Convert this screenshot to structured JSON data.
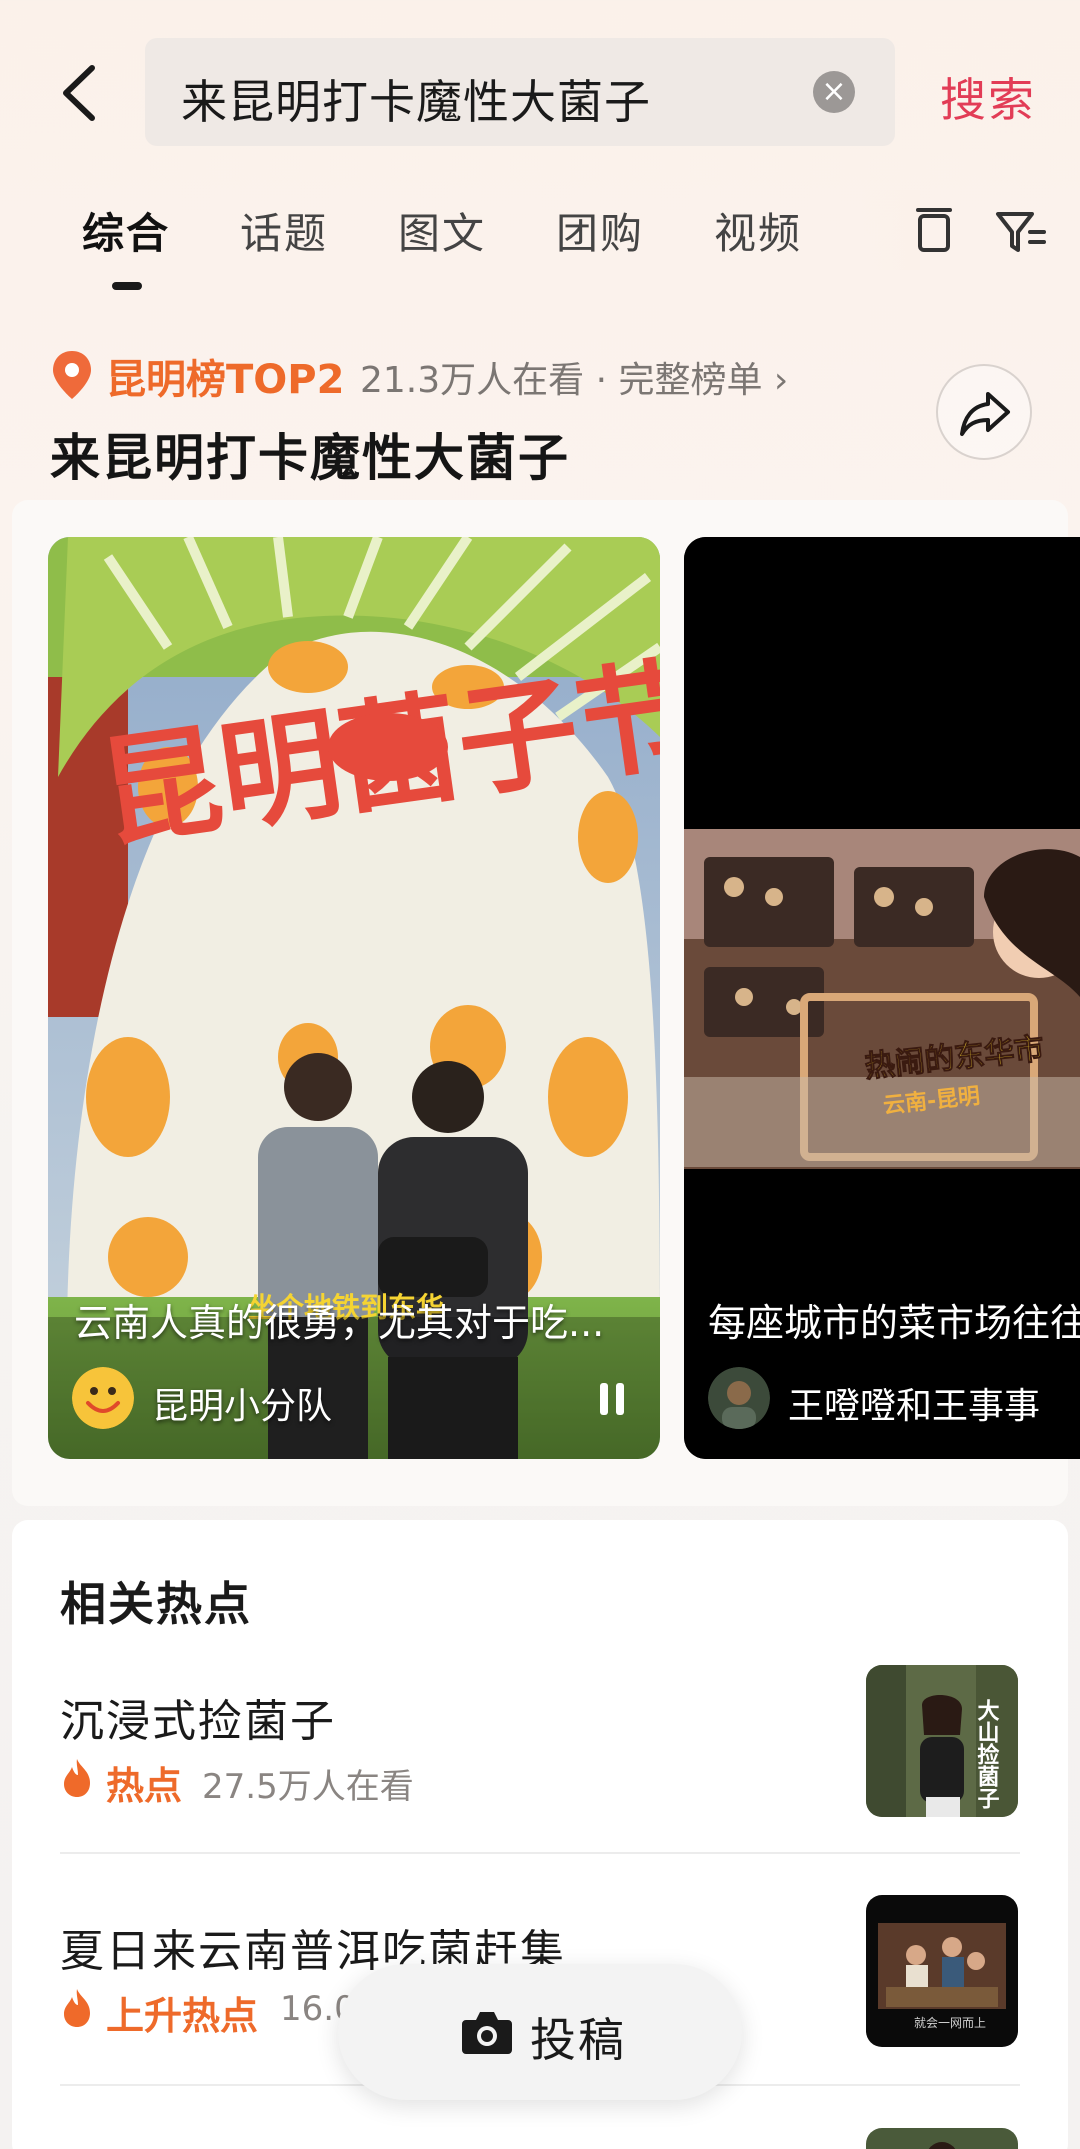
{
  "header": {
    "search_value": "来昆明打卡魔性大菌子",
    "search_button": "搜索"
  },
  "tabs": [
    {
      "label": "综合",
      "active": true
    },
    {
      "label": "话题",
      "active": false
    },
    {
      "label": "图文",
      "active": false
    },
    {
      "label": "团购",
      "active": false
    },
    {
      "label": "视频",
      "active": false
    }
  ],
  "rank": {
    "title": "昆明榜TOP2",
    "meta": "21.3万人在看 · 完整榜单 ›"
  },
  "page_title": "来昆明打卡魔性大菌子",
  "cards": [
    {
      "overlay_title": "昆明菌子节",
      "subtitle_overlay": "坐个地铁到东华",
      "caption": "云南人真的很勇，尤其对于吃...",
      "author": "昆明小分队"
    },
    {
      "overlay_title": "热闹的东华市",
      "overlay_sub": "云南-昆明",
      "caption": "每座城市的菜市场往往",
      "author": "王噔噔和王事事"
    }
  ],
  "related": {
    "heading": "相关热点",
    "items": [
      {
        "title": "沉浸式捡菌子",
        "tag": "热点",
        "views": "27.5万人在看",
        "thumb_text": "大山捡菌子"
      },
      {
        "title": "夏日来云南普洱吃菌赶集",
        "tag": "上升热点",
        "views": "16.0",
        "thumb_text": "就会一网而上"
      }
    ]
  },
  "post_button": "投稿",
  "colors": {
    "accent_red": "#e23c56",
    "accent_orange": "#ee6a2a"
  }
}
